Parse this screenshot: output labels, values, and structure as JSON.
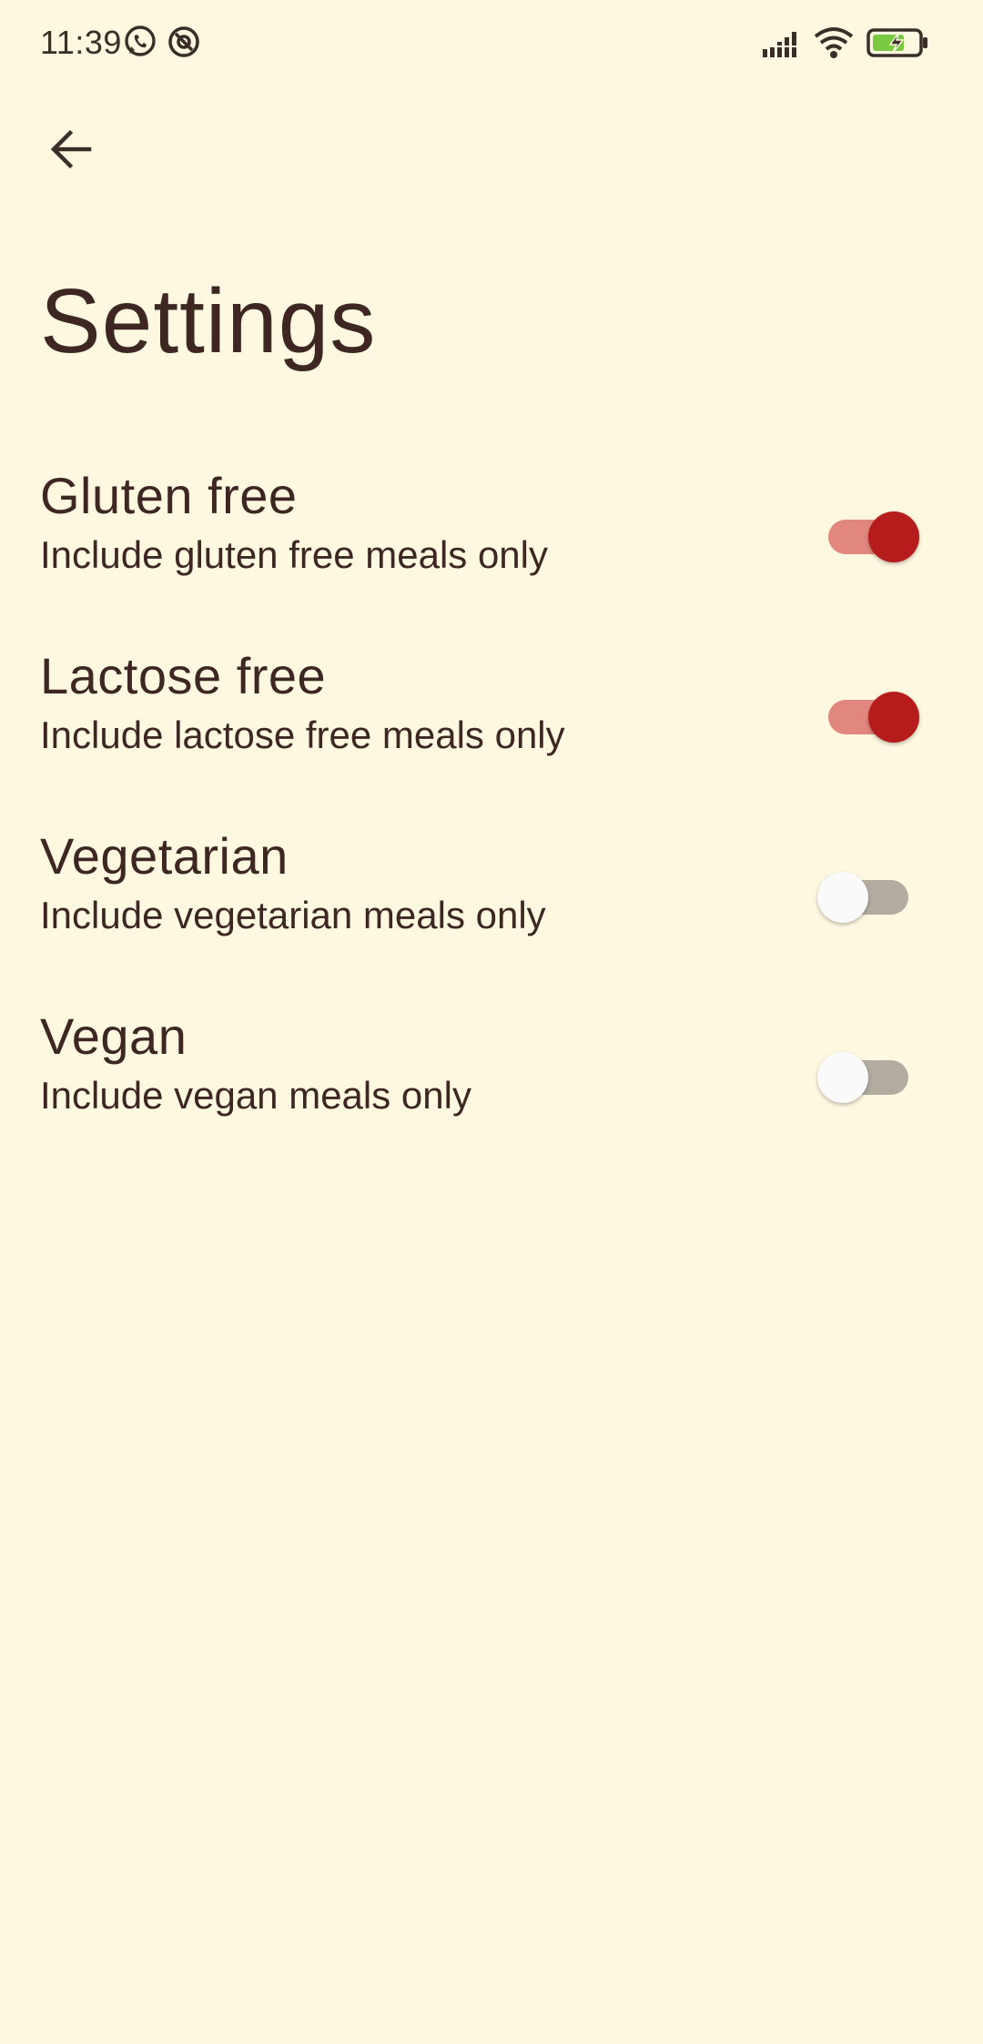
{
  "status_bar": {
    "time": "11:39",
    "left_icons": [
      "whatsapp-icon",
      "at-sign-icon"
    ],
    "right_icons": [
      "signal-icon",
      "wifi-icon",
      "battery-charging-icon"
    ]
  },
  "app_bar": {
    "back_icon": "arrow-left-icon"
  },
  "page": {
    "title": "Settings"
  },
  "settings": [
    {
      "title": "Gluten free",
      "subtitle": "Include gluten free meals only",
      "enabled": true
    },
    {
      "title": "Lactose free",
      "subtitle": "Include lactose free meals only",
      "enabled": true
    },
    {
      "title": "Vegetarian",
      "subtitle": "Include vegetarian meals only",
      "enabled": false
    },
    {
      "title": "Vegan",
      "subtitle": "Include vegan meals only",
      "enabled": false
    }
  ],
  "colors": {
    "background": "#fff8e1",
    "text": "#3e2723",
    "switch_on_thumb": "#b71c1c",
    "switch_on_track": "#e2877d",
    "switch_off_thumb": "#fafafa",
    "switch_off_track": "#b3aca1"
  }
}
